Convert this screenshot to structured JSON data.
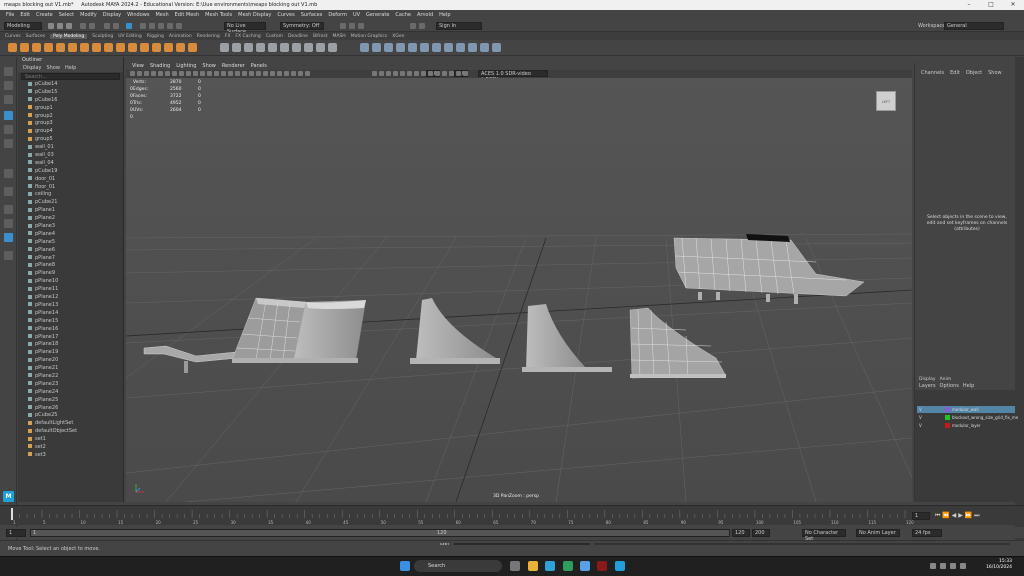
{
  "window": {
    "tab_title": "meaps blocking out V1.mb*",
    "title": "Autodesk MAYA 2024.2 - Educational Version: E:\\Uue environments\\meaps blocking out V1.mb"
  },
  "menubar": [
    "File",
    "Edit",
    "Create",
    "Select",
    "Modify",
    "Display",
    "Windows",
    "Mesh",
    "Edit Mesh",
    "Mesh Tools",
    "Mesh Display",
    "Curves",
    "Surfaces",
    "Deform",
    "UV",
    "Generate",
    "Cache",
    "Arnold",
    "Help"
  ],
  "workspace": {
    "label": "Workspace:",
    "value": "General"
  },
  "status": {
    "mode": "Modeling",
    "live": "No Live Surface",
    "symmetry": "Symmetry: Off",
    "signin": "Sign In"
  },
  "shelf_tabs": [
    "Curves",
    "Surfaces",
    "Poly Modeling",
    "Sculpting",
    "UV Editing",
    "Rigging",
    "Animation",
    "Rendering",
    "FX",
    "FX Caching",
    "Custom",
    "Deadline",
    "Bifrost",
    "MASH",
    "Motion Graphics",
    "XGen"
  ],
  "shelf_active": "Poly Modeling",
  "outliner": {
    "title": "Outliner",
    "menu": [
      "Display",
      "Show",
      "Help"
    ],
    "search_placeholder": "Search...",
    "items": [
      "pCube14",
      "pCube15",
      "pCube16",
      "group1",
      "group2",
      "group3",
      "group4",
      "group5",
      "wall_01",
      "wall_03",
      "wall_04",
      "pCube19",
      "door_01",
      "floor_01",
      "ceiling",
      "pCube21",
      "pPlane1",
      "pPlane2",
      "pPlane3",
      "pPlane4",
      "pPlane5",
      "pPlane6",
      "pPlane7",
      "pPlane8",
      "pPlane9",
      "pPlane10",
      "pPlane11",
      "pPlane12",
      "pPlane13",
      "pPlane14",
      "pPlane15",
      "pPlane16",
      "pPlane17",
      "pPlane18",
      "pPlane19",
      "pPlane20",
      "pPlane21",
      "pPlane22",
      "pPlane23",
      "pPlane24",
      "pPlane25",
      "pPlane26",
      "pCube25",
      "defaultLightSet",
      "defaultObjectSet",
      "set1",
      "set2",
      "set3"
    ]
  },
  "viewport": {
    "menu": [
      "View",
      "Shading",
      "Lighting",
      "Show",
      "Renderer",
      "Panels"
    ],
    "value1": "0.00",
    "value2": "1.00",
    "colorspace": "ACES 1.0 SDR-video (sRGB)",
    "camera": "3D PanZoom : persp",
    "viewcube": "LEFT",
    "hud": [
      {
        "k": "Verts:",
        "a": "2870",
        "b": "0",
        "c": "0"
      },
      {
        "k": "Edges:",
        "a": "2560",
        "b": "0",
        "c": "0"
      },
      {
        "k": "Faces:",
        "a": "3722",
        "b": "0",
        "c": "0"
      },
      {
        "k": "Tris:",
        "a": "4952",
        "b": "0",
        "c": "0"
      },
      {
        "k": "UVs:",
        "a": "2604",
        "b": "0",
        "c": "0"
      }
    ]
  },
  "channelbox": {
    "menu": [
      "Channels",
      "Edit",
      "Object",
      "Show"
    ],
    "message": "Select objects in the scene to view, edit and set keyframes on channels (attributes)"
  },
  "layers": {
    "tabs": [
      "Display",
      "Anim"
    ],
    "menu": [
      "Layers",
      "Options",
      "Help"
    ],
    "rows": [
      {
        "name": "modular_wall",
        "color": "#8a5bd6",
        "selected": true
      },
      {
        "name": "blockout_wrong_size_grid_fix_me",
        "color": "#22c422",
        "selected": false
      },
      {
        "name": "modular_layer",
        "color": "#c41a1a",
        "selected": false
      }
    ]
  },
  "timeline": {
    "ticks": [
      "1",
      "5",
      "10",
      "15",
      "20",
      "25",
      "30",
      "35",
      "40",
      "45",
      "50",
      "55",
      "60",
      "65",
      "70",
      "75",
      "80",
      "85",
      "90",
      "95",
      "100",
      "105",
      "110",
      "115",
      "120"
    ],
    "current": "1",
    "range_start": "1",
    "range_inner_start": "1",
    "range_inner_end": "120",
    "range_end": "120",
    "range_max": "200",
    "fps": "24 fps",
    "character": "No Character Set",
    "anim_layer": "No Anim Layer"
  },
  "cmdline": {
    "label": "MEL"
  },
  "helpline": "Move Tool: Select an object to move.",
  "taskbar": {
    "search": "Search",
    "time": "15:33",
    "date": "16/10/2024"
  },
  "colors": {
    "accent": "#1fa0d8",
    "shelf_orange": "#d98a3a"
  }
}
